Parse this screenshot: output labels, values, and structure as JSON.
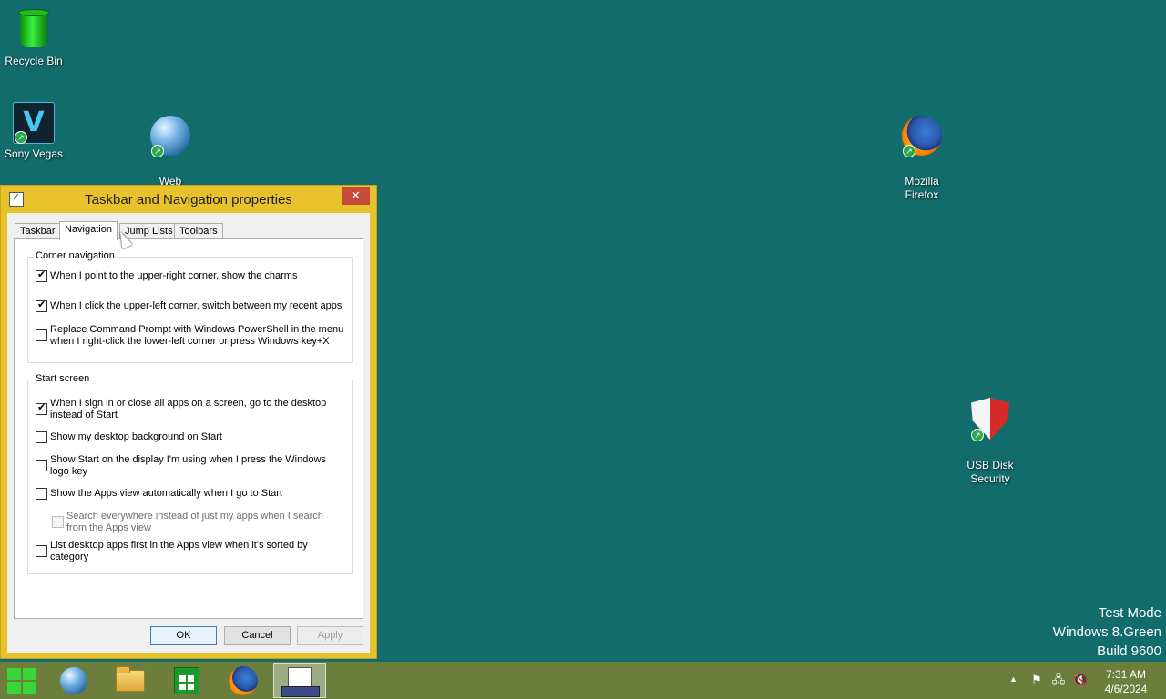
{
  "desktop": {
    "icons": [
      {
        "label": "Recycle Bin"
      },
      {
        "label": "Sony Vegas"
      },
      {
        "label": "Web\nNavigation"
      },
      {
        "label": "Mozilla\nFirefox"
      },
      {
        "label": "USB Disk\nSecurity"
      }
    ],
    "watermark": {
      "line1": "Test Mode",
      "line2": "Windows 8.Green",
      "line3": "Build 9600"
    }
  },
  "dialog": {
    "title": "Taskbar and Navigation properties",
    "close_label": "✕",
    "tabs": [
      {
        "label": "Taskbar",
        "active": false
      },
      {
        "label": "Navigation",
        "active": true
      },
      {
        "label": "Jump Lists",
        "active": false
      },
      {
        "label": "Toolbars",
        "active": false
      }
    ],
    "corner_navigation": {
      "heading": "Corner navigation",
      "options": [
        {
          "label": "When I point to the upper-right corner, show the charms",
          "checked": true
        },
        {
          "label": "When I click the upper-left corner, switch between my recent apps",
          "checked": true
        },
        {
          "label": "Replace Command Prompt with Windows PowerShell in the menu when I right-click the lower-left corner or press Windows key+X",
          "checked": false
        }
      ]
    },
    "start_screen": {
      "heading": "Start screen",
      "options": [
        {
          "label": "When I sign in or close all apps on a screen, go to the desktop instead of Start",
          "checked": true
        },
        {
          "label": "Show my desktop background on Start",
          "checked": false
        },
        {
          "label": "Show Start on the display I'm using when I press the Windows logo key",
          "checked": false
        },
        {
          "label": "Show the Apps view automatically when I go to Start",
          "checked": false
        },
        {
          "label": "Search everywhere instead of just my apps when I search from the Apps view",
          "checked": false,
          "disabled": true
        },
        {
          "label": "List desktop apps first in the Apps view when it's sorted by category",
          "checked": false
        }
      ]
    },
    "buttons": {
      "ok": "OK",
      "cancel": "Cancel",
      "apply": "Apply"
    }
  },
  "taskbar": {
    "items": [
      {
        "icon": "start-icon"
      },
      {
        "icon": "internet-explorer-icon"
      },
      {
        "icon": "file-explorer-icon"
      },
      {
        "icon": "store-icon"
      },
      {
        "icon": "firefox-icon"
      },
      {
        "icon": "properties-window-icon",
        "active": true
      }
    ],
    "tray": {
      "show_hidden": "▲",
      "time": "7:31 AM",
      "date": "4/6/2024"
    }
  },
  "colors": {
    "desktop_bg": "#136c6c",
    "dialog_frame": "#e8c22a",
    "taskbar_bg": "#6b7e3c",
    "close_button": "#c74a3a"
  }
}
